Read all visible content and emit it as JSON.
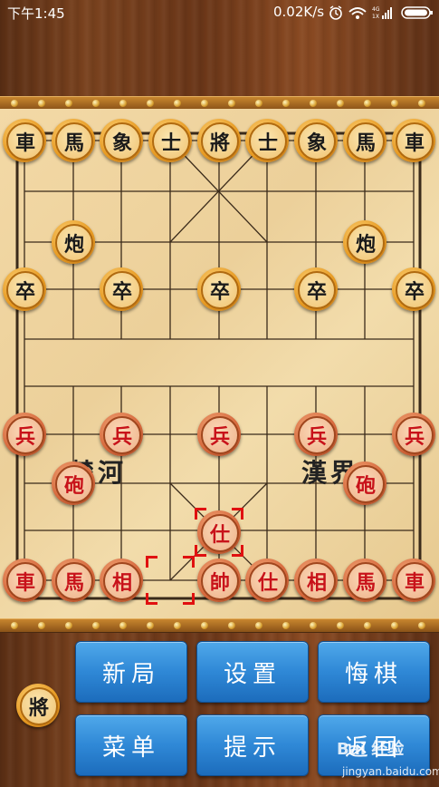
{
  "status_bar": {
    "time": "下午1:45",
    "network_speed": "0.02K/s",
    "network_type_top": "4G",
    "network_type_bottom": "1X",
    "icons": [
      "alarm-icon",
      "wifi-icon",
      "signal-icon",
      "battery-icon"
    ]
  },
  "board": {
    "river_left": "楚河",
    "river_right": "漢界",
    "black_back_rank": [
      "車",
      "馬",
      "象",
      "士",
      "將",
      "士",
      "象",
      "馬",
      "車"
    ],
    "black_cannons": [
      "炮",
      "炮"
    ],
    "black_soldiers": [
      "卒",
      "卒",
      "卒",
      "卒",
      "卒"
    ],
    "red_soldiers": [
      "兵",
      "兵",
      "兵",
      "兵",
      "兵"
    ],
    "red_cannons": [
      "砲",
      "砲"
    ],
    "red_advisor_moved": "仕",
    "red_back_rank": [
      "車",
      "馬",
      "相",
      "帥",
      "仕",
      "相",
      "馬",
      "車"
    ],
    "colors": {
      "red_text": "#c8121a",
      "black_text": "#1a1a1a",
      "selection": "#e01010"
    }
  },
  "turn_indicator": {
    "label": "將"
  },
  "buttons": {
    "new_game": "新局",
    "settings": "设置",
    "undo": "悔棋",
    "menu": "菜单",
    "hint": "提示",
    "back": "返回"
  },
  "watermark": {
    "main": "Bai 经验",
    "sub": "jingyan.baidu.com"
  }
}
